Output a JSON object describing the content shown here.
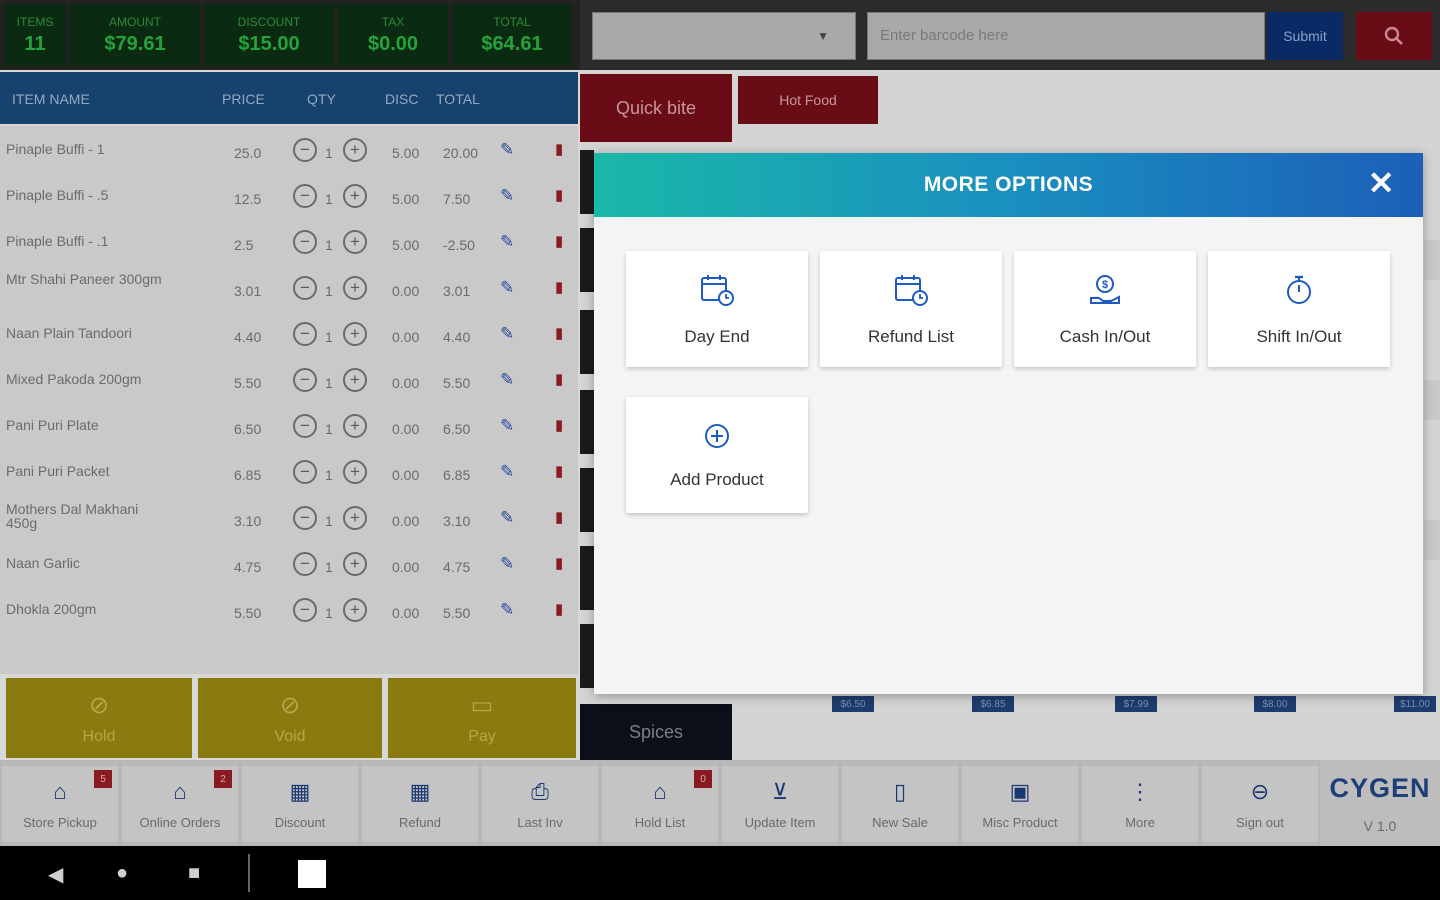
{
  "summary": {
    "items": {
      "label": "ITEMS",
      "value": "11"
    },
    "amount": {
      "label": "AMOUNT",
      "value": "$79.61"
    },
    "discount": {
      "label": "DISCOUNT",
      "value": "$15.00"
    },
    "tax": {
      "label": "TAX",
      "value": "$0.00"
    },
    "total": {
      "label": "TOTAL",
      "value": "$64.61"
    }
  },
  "barcode": {
    "placeholder": "Enter barcode here",
    "submit_label": "Submit"
  },
  "table": {
    "headers": {
      "name": "ITEM NAME",
      "price": "PRICE",
      "qty": "QTY",
      "disc": "DISC",
      "total": "TOTAL"
    },
    "rows": [
      {
        "name": "Pinaple Buffi - 1",
        "price": "25.0",
        "qty": "1",
        "disc": "5.00",
        "total": "20.00"
      },
      {
        "name": "Pinaple Buffi - .5",
        "price": "12.5",
        "qty": "1",
        "disc": "5.00",
        "total": "7.50"
      },
      {
        "name": "Pinaple Buffi - .1",
        "price": "2.5",
        "qty": "1",
        "disc": "5.00",
        "total": "-2.50"
      },
      {
        "name": "Mtr Shahi Paneer 300gm",
        "price": "3.01",
        "qty": "1",
        "disc": "0.00",
        "total": "3.01"
      },
      {
        "name": "Naan Plain Tandoori",
        "price": "4.40",
        "qty": "1",
        "disc": "0.00",
        "total": "4.40"
      },
      {
        "name": "Mixed Pakoda 200gm",
        "price": "5.50",
        "qty": "1",
        "disc": "0.00",
        "total": "5.50"
      },
      {
        "name": "Pani Puri Plate",
        "price": "6.50",
        "qty": "1",
        "disc": "0.00",
        "total": "6.50"
      },
      {
        "name": "Pani Puri Packet",
        "price": "6.85",
        "qty": "1",
        "disc": "0.00",
        "total": "6.85"
      },
      {
        "name": "Mothers Dal Makhani 450g",
        "price": "3.10",
        "qty": "1",
        "disc": "0.00",
        "total": "3.10"
      },
      {
        "name": "Naan Garlic",
        "price": "4.75",
        "qty": "1",
        "disc": "0.00",
        "total": "4.75"
      },
      {
        "name": "Dhokla 200gm",
        "price": "5.50",
        "qty": "1",
        "disc": "0.00",
        "total": "5.50"
      }
    ]
  },
  "actions": {
    "hold": "Hold",
    "void": "Void",
    "pay": "Pay"
  },
  "categories": {
    "quick_bite": "Quick bite",
    "hot_food": "Hot Food",
    "spices": "Spices"
  },
  "price_tags": [
    "$6.50",
    "$6.85",
    "$7.99",
    "$8.00",
    "$11.00"
  ],
  "bottom_nav": {
    "store_pickup": {
      "label": "Store Pickup",
      "badge": "5"
    },
    "online_orders": {
      "label": "Online Orders",
      "badge": "2"
    },
    "discount": {
      "label": "Discount"
    },
    "refund": {
      "label": "Refund"
    },
    "last_inv": {
      "label": "Last Inv"
    },
    "hold_list": {
      "label": "Hold List",
      "badge": "0"
    },
    "update_item": {
      "label": "Update Item"
    },
    "new_sale": {
      "label": "New Sale"
    },
    "misc_product": {
      "label": "Misc Product"
    },
    "more": {
      "label": "More"
    },
    "sign_out": {
      "label": "Sign out"
    }
  },
  "brand": {
    "name": "CYGEN",
    "version": "V 1.0"
  },
  "modal": {
    "title": "MORE OPTIONS",
    "options": {
      "day_end": "Day End",
      "refund_list": "Refund List",
      "cash_in_out": "Cash In/Out",
      "shift_in_out": "Shift In/Out",
      "add_product": "Add Product"
    }
  },
  "colors": {
    "header_gradient_start": "#1ab8a8",
    "header_gradient_end": "#1c5fb8",
    "icon_blue": "#1e5bc1",
    "accent_red": "#6a0c16"
  }
}
